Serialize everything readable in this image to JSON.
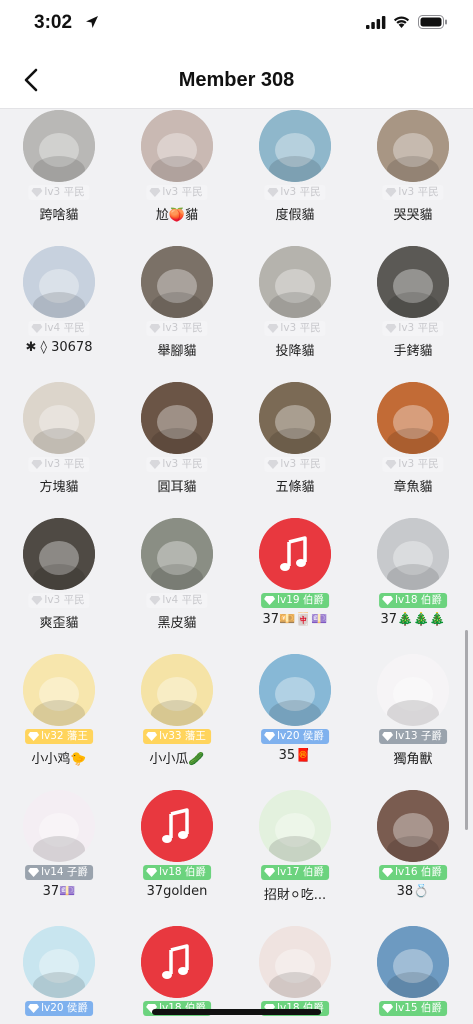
{
  "status": {
    "time": "3:02"
  },
  "header": {
    "title": "Member 308"
  },
  "members": [
    {
      "name": "跨啥貓",
      "badge": "lv3 平民",
      "tier": "gray",
      "avatar": "cat-gray-white",
      "bg": "#b9b8b6"
    },
    {
      "name": "尬🍑貓",
      "badge": "lv3 平民",
      "tier": "gray",
      "avatar": "cat-blurry",
      "bg": "#c9b9b3"
    },
    {
      "name": "度假貓",
      "badge": "lv3 平民",
      "tier": "gray",
      "avatar": "cat-sunhat",
      "bg": "#8fb7cb"
    },
    {
      "name": "哭哭貓",
      "badge": "lv3 平民",
      "tier": "gray",
      "avatar": "cat-white-crying",
      "bg": "#a89684"
    },
    {
      "name": "✱ ◊ 30678",
      "badge": "lv4 平民",
      "tier": "gray",
      "avatar": "baby-green-dress",
      "bg": "#c7d1de"
    },
    {
      "name": "舉腳貓",
      "badge": "lv3 平民",
      "tier": "gray",
      "avatar": "cat-cream",
      "bg": "#7b7167"
    },
    {
      "name": "投降貓",
      "badge": "lv3 平民",
      "tier": "gray",
      "avatar": "cat-upside-down",
      "bg": "#b5b3ad"
    },
    {
      "name": "手銬貓",
      "badge": "lv3 平民",
      "tier": "gray",
      "avatar": "cat-tuxedo",
      "bg": "#5b5955"
    },
    {
      "name": "方塊貓",
      "badge": "lv3 平民",
      "tier": "gray",
      "avatar": "cat-toast",
      "bg": "#dcd5cb"
    },
    {
      "name": "圓耳貓",
      "badge": "lv3 平民",
      "tier": "gray",
      "avatar": "cat-calico",
      "bg": "#6b5546"
    },
    {
      "name": "五條貓",
      "badge": "lv3 平民",
      "tier": "gray",
      "avatar": "cat-sunglasses",
      "bg": "#7b6a55"
    },
    {
      "name": "章魚貓",
      "badge": "lv3 平民",
      "tier": "gray",
      "avatar": "cat-octopus-hat",
      "bg": "#c26b36"
    },
    {
      "name": "爽歪貓",
      "badge": "lv3 平民",
      "tier": "gray",
      "avatar": "cat-held",
      "bg": "#4f4a44"
    },
    {
      "name": "黑皮貓",
      "badge": "lv4 平民",
      "tier": "gray",
      "avatar": "cat-pillow",
      "bg": "#8a8e84"
    },
    {
      "name": "37💴🀄💷",
      "badge": "lv19 伯爵",
      "tier": "green",
      "avatar": "music-app-icon",
      "bg": "#e8383f"
    },
    {
      "name": "37🎄🎄🎄",
      "badge": "lv18 伯爵",
      "tier": "green",
      "avatar": "girl-portrait",
      "bg": "#c7c9cc"
    },
    {
      "name": "小小鸡🐤",
      "badge": "lv32 藩王",
      "tier": "gold",
      "avatar": "chick-cartoon",
      "bg": "#f7e6ad"
    },
    {
      "name": "小小瓜🥒",
      "badge": "lv33 藩王",
      "tier": "gold",
      "avatar": "frog-cartoon",
      "bg": "#f5e3a6"
    },
    {
      "name": "35🧧",
      "badge": "lv20 侯爵",
      "tier": "blue",
      "avatar": "beach-girl",
      "bg": "#87b8d6"
    },
    {
      "name": "獨角獸",
      "badge": "lv13 子爵",
      "tier": "slate",
      "avatar": "unicorn-plush",
      "bg": "#f6f4f6"
    },
    {
      "name": "37💷",
      "badge": "lv14 子爵",
      "tier": "slate",
      "avatar": "blank-pink",
      "bg": "#f4eef3"
    },
    {
      "name": "37golden",
      "badge": "lv18 伯爵",
      "tier": "green",
      "avatar": "music-app-icon",
      "bg": "#e8383f"
    },
    {
      "name": "招財⚪吃...",
      "badge": "lv17 伯爵",
      "tier": "green",
      "avatar": "anime-girl-green",
      "bg": "#e3f1de"
    },
    {
      "name": "38💍",
      "badge": "lv16 伯爵",
      "tier": "green",
      "avatar": "woman-portrait",
      "bg": "#7a5c50"
    },
    {
      "name": "",
      "badge": "lv20 侯爵",
      "tier": "blue",
      "avatar": "anime-shouting",
      "bg": "#c8e5ef"
    },
    {
      "name": "",
      "badge": "lv18 伯爵",
      "tier": "green",
      "avatar": "music-app-icon",
      "bg": "#e8383f"
    },
    {
      "name": "",
      "badge": "lv18 伯爵",
      "tier": "green",
      "avatar": "anime-girl-flowers",
      "bg": "#efe3e0"
    },
    {
      "name": "",
      "badge": "lv15 伯爵",
      "tier": "green",
      "avatar": "beach-photo",
      "bg": "#6d9ac1"
    }
  ]
}
